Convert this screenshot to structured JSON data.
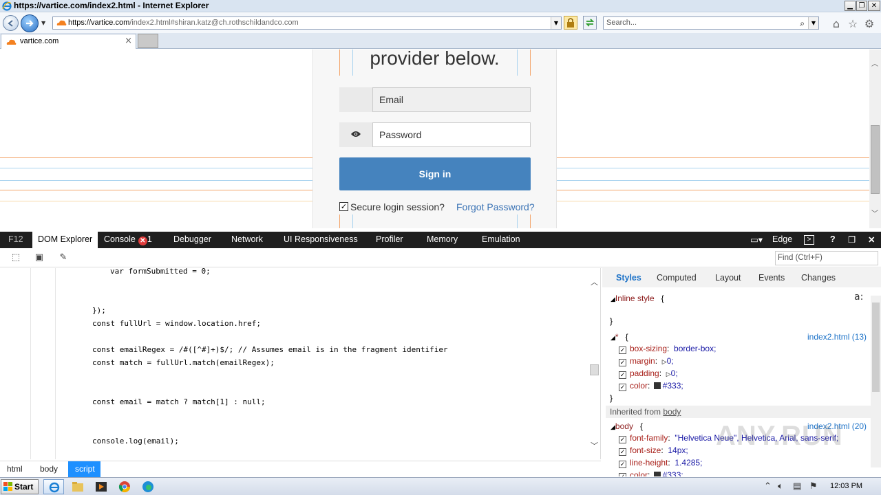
{
  "window": {
    "title": "https://vartice.com/index2.html - Internet Explorer"
  },
  "address": {
    "url_host": "https://vartice.com",
    "url_rest": "/index2.html#shiran.katz@ch.rothschildandco.com"
  },
  "search": {
    "placeholder": "Search..."
  },
  "tab": {
    "label": "vartice.com"
  },
  "page": {
    "heading": "provider below.",
    "email_placeholder": "Email",
    "password_placeholder": "Password",
    "signin_label": "Sign in",
    "secure_label": "Secure login session?",
    "forgot_label": "Forgot Password?"
  },
  "devtools": {
    "tabs": [
      "F12",
      "DOM Explorer",
      "Console",
      "Debugger",
      "Network",
      "UI Responsiveness",
      "Profiler",
      "Memory",
      "Emulation"
    ],
    "console_error_count": "1",
    "mode_label": "Edge",
    "find_placeholder": "Find (Ctrl+F)",
    "code_lines": [
      "var formSubmitted = 0;",
      "});",
      "const fullUrl = window.location.href;",
      "const emailRegex = /#([^#]+)$/; // Assumes email is in the fragment identifier",
      "const match = fullUrl.match(emailRegex);",
      "const email = match ? match[1] : null;",
      "console.log(email);"
    ],
    "breadcrumbs": [
      "html",
      "body",
      "script"
    ],
    "style_tabs": [
      "Styles",
      "Computed",
      "Layout",
      "Events",
      "Changes"
    ],
    "styles": {
      "inline_label": "Inline style",
      "open_brace": "{",
      "close_brace": "}",
      "rule1_selector": "*",
      "rule1_source": "index2.html (13)",
      "rule1_props": [
        {
          "prop": "box-sizing",
          "value": "border-box;"
        },
        {
          "prop": "margin",
          "value": "0;"
        },
        {
          "prop": "padding",
          "value": "0;"
        },
        {
          "prop": "color",
          "value": "#333;"
        }
      ],
      "inherited_prefix": "Inherited from",
      "inherited_from": "body",
      "rule2_selector": "body",
      "rule2_source": "index2.html (20)",
      "rule2_props": [
        {
          "prop": "font-family",
          "value": "\"Helvetica Neue\", Helvetica, Arial, sans-serif;"
        },
        {
          "prop": "font-size",
          "value": "14px;"
        },
        {
          "prop": "line-height",
          "value": "1.4285;"
        },
        {
          "prop": "color",
          "value": "#333;"
        }
      ]
    },
    "watermark": "ANY.RUN"
  },
  "taskbar": {
    "start_label": "Start",
    "clock": "12:03 PM"
  },
  "colors": {
    "signin": "#4583be",
    "link": "#3a73b5",
    "devtools_bar": "#1f1f1f",
    "crumb_active": "#1e90ff"
  }
}
